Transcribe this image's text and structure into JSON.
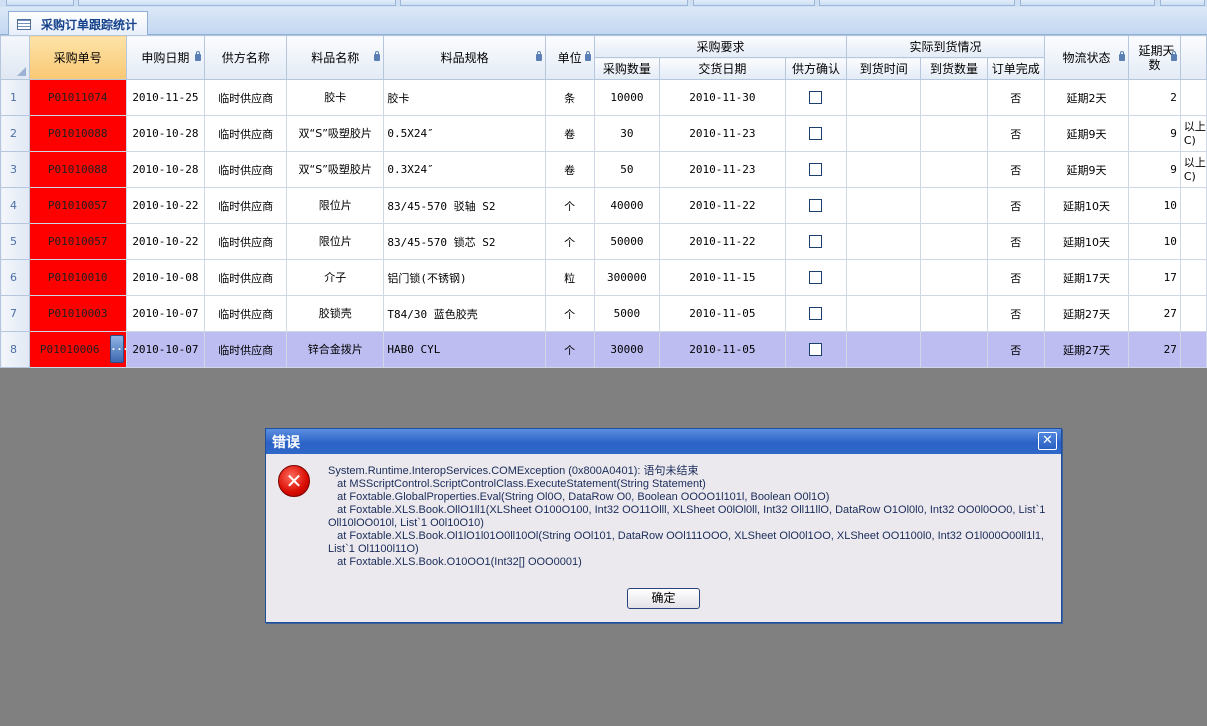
{
  "tab": {
    "title": "采购订单跟踪统计"
  },
  "headers": {
    "order_no": "采购单号",
    "apply_date": "申购日期",
    "supplier": "供方名称",
    "material": "料品名称",
    "spec": "料品规格",
    "unit": "单位",
    "group_req": "采购要求",
    "qty": "采购数量",
    "delivery": "交货日期",
    "supplier_confirm": "供方确认",
    "group_actual": "实际到货情况",
    "arrive_time": "到货时间",
    "arrive_qty": "到货数量",
    "order_done": "订单完成",
    "logistics": "物流状态",
    "delay_days": "延期天数"
  },
  "rows": [
    {
      "n": "1",
      "order": "P01011074",
      "date": "2010-11-25",
      "supplier": "临时供应商",
      "material": "胶卡",
      "spec": "胶卡",
      "unit": "条",
      "qty": "10000",
      "delivery": "2010-11-30",
      "done": "否",
      "status": "延期2天",
      "delay": "2",
      "extra": ""
    },
    {
      "n": "2",
      "order": "P01010088",
      "date": "2010-10-28",
      "supplier": "临时供应商",
      "material": "双“S”吸塑胶片",
      "spec": "0.5X24″",
      "unit": "卷",
      "qty": "30",
      "delivery": "2010-11-23",
      "done": "否",
      "status": "延期9天",
      "delay": "9",
      "extra": "以上\nC)"
    },
    {
      "n": "3",
      "order": "P01010088",
      "date": "2010-10-28",
      "supplier": "临时供应商",
      "material": "双“S”吸塑胶片",
      "spec": "0.3X24″",
      "unit": "卷",
      "qty": "50",
      "delivery": "2010-11-23",
      "done": "否",
      "status": "延期9天",
      "delay": "9",
      "extra": "以上\nC)"
    },
    {
      "n": "4",
      "order": "P01010057",
      "date": "2010-10-22",
      "supplier": "临时供应商",
      "material": "限位片",
      "spec": "83/45-570    驳轴 S2",
      "unit": "个",
      "qty": "40000",
      "delivery": "2010-11-22",
      "done": "否",
      "status": "延期10天",
      "delay": "10",
      "extra": ""
    },
    {
      "n": "5",
      "order": "P01010057",
      "date": "2010-10-22",
      "supplier": "临时供应商",
      "material": "限位片",
      "spec": "83/45-570    锁芯 S2",
      "unit": "个",
      "qty": "50000",
      "delivery": "2010-11-22",
      "done": "否",
      "status": "延期10天",
      "delay": "10",
      "extra": ""
    },
    {
      "n": "6",
      "order": "P01010010",
      "date": "2010-10-08",
      "supplier": "临时供应商",
      "material": "介子",
      "spec": "铝门锁(不锈钢)",
      "unit": "粒",
      "qty": "300000",
      "delivery": "2010-11-15",
      "done": "否",
      "status": "延期17天",
      "delay": "17",
      "extra": ""
    },
    {
      "n": "7",
      "order": "P01010003",
      "date": "2010-10-07",
      "supplier": "临时供应商",
      "material": "胶锁壳",
      "spec": "T84/30  蓝色胶壳",
      "unit": "个",
      "qty": "5000",
      "delivery": "2010-11-05",
      "done": "否",
      "status": "延期27天",
      "delay": "27",
      "extra": ""
    },
    {
      "n": "8",
      "order": "P01010006",
      "date": "2010-10-07",
      "supplier": "临时供应商",
      "material": "锌合金拨片",
      "spec": "HAB0  CYL",
      "unit": "个",
      "qty": "30000",
      "delivery": "2010-11-05",
      "done": "否",
      "status": "延期27天",
      "delay": "27",
      "extra": ""
    }
  ],
  "dialog": {
    "title": "错误",
    "close_glyph": "✕",
    "icon_glyph": "✕",
    "lines": [
      "System.Runtime.InteropServices.COMException (0x800A0401): 语句未结束",
      "   at MSScriptControl.ScriptControlClass.ExecuteStatement(String Statement)",
      "   at Foxtable.GlobalProperties.Eval(String Ol0O, DataRow O0, Boolean OOOO1l101l, Boolean O0l1O)",
      "   at Foxtable.XLS.Book.OllO1ll1(XLSheet O100O100, Int32 OO11Olll, XLSheet O0lOl0ll, Int32 Oll11llO, DataRow O1Ol0l0, Int32 OO0l0OO0, List`1 Oll10lOO010l, List`1 O0l10O10)",
      "   at Foxtable.XLS.Book.Ol1lO1l01O0ll10Ol(String OOl101, DataRow OOl111OOO, XLSheet OlO0l1OO, XLSheet OO1100l0, Int32 O1l000O00ll1l1, List`1 Ol1100l11O)",
      "   at Foxtable.XLS.Book.O10OO1(Int32[] OOO0001)"
    ],
    "ok_label": "确定"
  },
  "colors": {
    "overdue_fill": "#ff0000",
    "selected_row": "#bdbdf2",
    "dialog_title": "#2c62c6"
  }
}
